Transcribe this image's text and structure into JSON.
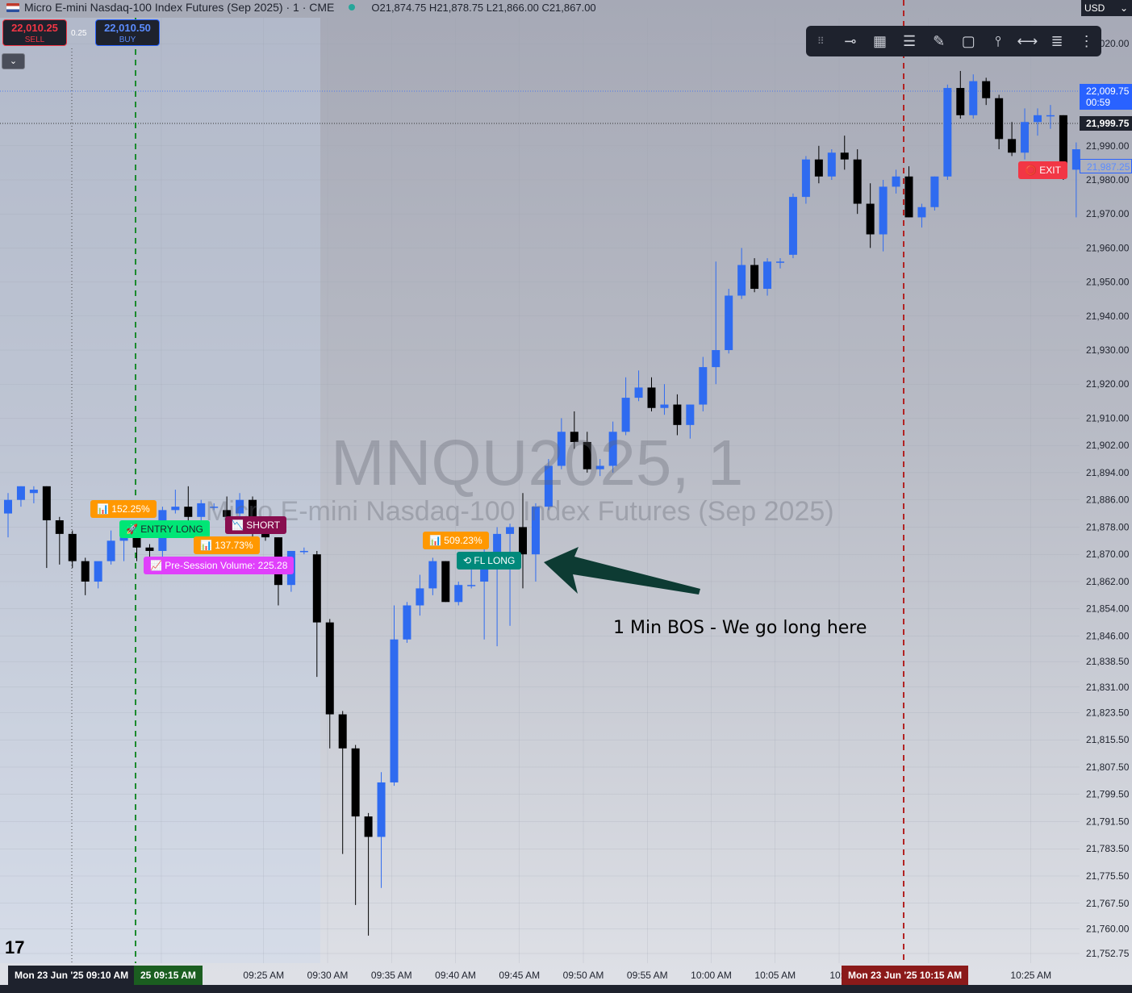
{
  "header": {
    "title": "Micro E-mini Nasdaq-100 Index Futures (Sep 2025) · 1 · CME",
    "ohlc": "O21,874.75  H21,878.75  L21,866.00  C21,867.00",
    "currency": "USD"
  },
  "trade_panel": {
    "sell_price": "22,010.25",
    "sell_label": "SELL",
    "spread": "0.25",
    "buy_price": "22,010.50",
    "buy_label": "BUY"
  },
  "watermark": {
    "symbol": "MNQU2025, 1",
    "name": "Micro E-mini Nasdaq-100 Index Futures (Sep 2025)"
  },
  "labels": {
    "vol1": "📊 152.25%",
    "entry_long": "🚀 ENTRY LONG",
    "short": "📉 SHORT",
    "vol2": "📊 137.73%",
    "presession": "📈 Pre-Session Volume: 225.28",
    "vol3": "📊 509.23%",
    "fl_long": "⟲ FL LONG",
    "exit": "⭕ EXIT",
    "annotation": "1 Min BOS - We go long here"
  },
  "price_tags": {
    "ask": "22,009.75",
    "countdown": "00:59",
    "crosshair": "21,999.75",
    "exit_level": "21,987.25"
  },
  "time_tags": {
    "left": "Mon 23 Jun '25   09:10 AM",
    "green": "25   09:15 AM",
    "red": "Mon 23 Jun '25   10:15 AM"
  },
  "colors": {
    "up": "#2f6bf0",
    "down": "#000000",
    "sell": "#f23645",
    "buy": "#2962ff",
    "green_line": "#1b8a2e",
    "red_line": "#b22222",
    "arrow": "#0d3b33"
  },
  "toolbar": {
    "icons": [
      "drag-handle-icon",
      "line-tool-icon",
      "grid-icon",
      "lines-icon",
      "brush-icon",
      "rectangle-icon",
      "vertical-line-icon",
      "horizontal-line-icon",
      "settings-lines-icon",
      "menu-lines-icon"
    ]
  },
  "chart_data": {
    "type": "candlestick",
    "ylim": [
      21752.75,
      22030.0
    ],
    "yticks": [
      22020.0,
      21990.0,
      21980.0,
      21970.0,
      21960.0,
      21950.0,
      21940.0,
      21930.0,
      21920.0,
      21910.0,
      21902.0,
      21894.0,
      21886.0,
      21878.0,
      21870.0,
      21862.0,
      21854.0,
      21846.0,
      21838.5,
      21831.0,
      21823.5,
      21815.5,
      21807.5,
      21799.5,
      21791.5,
      21783.5,
      21775.5,
      21767.5,
      21760.0,
      21752.75
    ],
    "ytick_labels": [
      "22,020.00",
      "21,990.00",
      "21,980.00",
      "21,970.00",
      "21,960.00",
      "21,950.00",
      "21,940.00",
      "21,930.00",
      "21,920.00",
      "21,910.00",
      "21,902.00",
      "21,894.00",
      "21,886.00",
      "21,878.00",
      "21,870.00",
      "21,862.00",
      "21,854.00",
      "21,846.00",
      "21,838.50",
      "21,831.00",
      "21,823.50",
      "21,815.50",
      "21,807.50",
      "21,799.50",
      "21,791.50",
      "21,783.50",
      "21,775.50",
      "21,767.50",
      "21,760.00",
      "21,752.75"
    ],
    "xtick_labels": [
      "0 AM",
      "09:25 AM",
      "09:30 AM",
      "09:35 AM",
      "09:40 AM",
      "09:45 AM",
      "09:50 AM",
      "09:55 AM",
      "10:00 AM",
      "10:05 AM",
      "10:1",
      "0 AM",
      "10:25 AM"
    ],
    "xtick_minutes": [
      17,
      25,
      30,
      35,
      40,
      45,
      50,
      55,
      60,
      65,
      70,
      77,
      85
    ],
    "candles": [
      {
        "o": 21882,
        "h": 21888,
        "l": 21875,
        "c": 21886
      },
      {
        "o": 21886,
        "h": 21890,
        "l": 21884,
        "c": 21890
      },
      {
        "o": 21888,
        "h": 21890,
        "l": 21885,
        "c": 21889
      },
      {
        "o": 21890,
        "h": 21890,
        "l": 21866,
        "c": 21880
      },
      {
        "o": 21880,
        "h": 21881,
        "l": 21867,
        "c": 21876
      },
      {
        "o": 21876,
        "h": 21877,
        "l": 21866,
        "c": 21868
      },
      {
        "o": 21868,
        "h": 21869,
        "l": 21858,
        "c": 21862
      },
      {
        "o": 21862,
        "h": 21867,
        "l": 21860,
        "c": 21868
      },
      {
        "o": 21868,
        "h": 21877,
        "l": 21867,
        "c": 21874
      },
      {
        "o": 21874,
        "h": 21876,
        "l": 21868,
        "c": 21875
      },
      {
        "o": 21875,
        "h": 21878,
        "l": 21868,
        "c": 21872
      },
      {
        "o": 21872,
        "h": 21873,
        "l": 21868,
        "c": 21871
      },
      {
        "o": 21871,
        "h": 21884,
        "l": 21869,
        "c": 21883
      },
      {
        "o": 21883,
        "h": 21889,
        "l": 21882,
        "c": 21884
      },
      {
        "o": 21884,
        "h": 21890,
        "l": 21880,
        "c": 21881
      },
      {
        "o": 21881,
        "h": 21886,
        "l": 21879,
        "c": 21885
      },
      {
        "o": 21884,
        "h": 21885,
        "l": 21883,
        "c": 21884
      },
      {
        "o": 21883,
        "h": 21887,
        "l": 21880,
        "c": 21881
      },
      {
        "o": 21882,
        "h": 21888,
        "l": 21879,
        "c": 21886
      },
      {
        "o": 21886,
        "h": 21887,
        "l": 21874,
        "c": 21877
      },
      {
        "o": 21877,
        "h": 21877,
        "l": 21874,
        "c": 21875
      },
      {
        "o": 21875,
        "h": 21875,
        "l": 21855,
        "c": 21861
      },
      {
        "o": 21861,
        "h": 21871,
        "l": 21859,
        "c": 21871
      },
      {
        "o": 21871,
        "h": 21872,
        "l": 21870,
        "c": 21871
      },
      {
        "o": 21870,
        "h": 21871,
        "l": 21834,
        "c": 21850
      },
      {
        "o": 21850,
        "h": 21851,
        "l": 21813,
        "c": 21823
      },
      {
        "o": 21823,
        "h": 21824,
        "l": 21782,
        "c": 21813
      },
      {
        "o": 21813,
        "h": 21814,
        "l": 21767,
        "c": 21793
      },
      {
        "o": 21793,
        "h": 21794,
        "l": 21758,
        "c": 21787
      },
      {
        "o": 21787,
        "h": 21806,
        "l": 21772,
        "c": 21803
      },
      {
        "o": 21803,
        "h": 21855,
        "l": 21802,
        "c": 21845
      },
      {
        "o": 21845,
        "h": 21856,
        "l": 21844,
        "c": 21855
      },
      {
        "o": 21855,
        "h": 21864,
        "l": 21852,
        "c": 21860
      },
      {
        "o": 21860,
        "h": 21869,
        "l": 21858,
        "c": 21868
      },
      {
        "o": 21868,
        "h": 21868,
        "l": 21856,
        "c": 21856
      },
      {
        "o": 21856,
        "h": 21862,
        "l": 21855,
        "c": 21861
      },
      {
        "o": 21861,
        "h": 21870,
        "l": 21860,
        "c": 21861
      },
      {
        "o": 21862,
        "h": 21876,
        "l": 21845,
        "c": 21868
      },
      {
        "o": 21868,
        "h": 21878,
        "l": 21843,
        "c": 21876
      },
      {
        "o": 21876,
        "h": 21879,
        "l": 21849,
        "c": 21878
      },
      {
        "o": 21878,
        "h": 21888,
        "l": 21860,
        "c": 21870
      },
      {
        "o": 21870,
        "h": 21885,
        "l": 21862,
        "c": 21884
      },
      {
        "o": 21884,
        "h": 21898,
        "l": 21883,
        "c": 21896
      },
      {
        "o": 21896,
        "h": 21910,
        "l": 21895,
        "c": 21906
      },
      {
        "o": 21906,
        "h": 21912,
        "l": 21901,
        "c": 21903
      },
      {
        "o": 21903,
        "h": 21906,
        "l": 21894,
        "c": 21895
      },
      {
        "o": 21895,
        "h": 21898,
        "l": 21893,
        "c": 21896
      },
      {
        "o": 21896,
        "h": 21909,
        "l": 21894,
        "c": 21906
      },
      {
        "o": 21906,
        "h": 21922,
        "l": 21905,
        "c": 21916
      },
      {
        "o": 21916,
        "h": 21924,
        "l": 21915,
        "c": 21919
      },
      {
        "o": 21919,
        "h": 21922,
        "l": 21912,
        "c": 21913
      },
      {
        "o": 21913,
        "h": 21920,
        "l": 21911,
        "c": 21914
      },
      {
        "o": 21914,
        "h": 21917,
        "l": 21905,
        "c": 21908
      },
      {
        "o": 21908,
        "h": 21914,
        "l": 21904,
        "c": 21914
      },
      {
        "o": 21914,
        "h": 21928,
        "l": 21912,
        "c": 21925
      },
      {
        "o": 21925,
        "h": 21956,
        "l": 21920,
        "c": 21930
      },
      {
        "o": 21930,
        "h": 21948,
        "l": 21929,
        "c": 21946
      },
      {
        "o": 21946,
        "h": 21960,
        "l": 21945,
        "c": 21955
      },
      {
        "o": 21955,
        "h": 21957,
        "l": 21947,
        "c": 21948
      },
      {
        "o": 21948,
        "h": 21957,
        "l": 21946,
        "c": 21956
      },
      {
        "o": 21956,
        "h": 21957,
        "l": 21954,
        "c": 21956
      },
      {
        "o": 21958,
        "h": 21976,
        "l": 21957,
        "c": 21975
      },
      {
        "o": 21975,
        "h": 21987,
        "l": 21973,
        "c": 21986
      },
      {
        "o": 21986,
        "h": 21990,
        "l": 21979,
        "c": 21981
      },
      {
        "o": 21981,
        "h": 21989,
        "l": 21980,
        "c": 21988
      },
      {
        "o": 21988,
        "h": 21993,
        "l": 21983,
        "c": 21986
      },
      {
        "o": 21986,
        "h": 21989,
        "l": 21970,
        "c": 21973
      },
      {
        "o": 21973,
        "h": 21979,
        "l": 21960,
        "c": 21964
      },
      {
        "o": 21964,
        "h": 21980,
        "l": 21959,
        "c": 21978
      },
      {
        "o": 21978,
        "h": 21983,
        "l": 21976,
        "c": 21981
      },
      {
        "o": 21981,
        "h": 21984,
        "l": 21969,
        "c": 21969
      },
      {
        "o": 21969,
        "h": 21973,
        "l": 21966,
        "c": 21972
      },
      {
        "o": 21972,
        "h": 21981,
        "l": 21971,
        "c": 21981
      },
      {
        "o": 21981,
        "h": 22008,
        "l": 21980,
        "c": 22007
      },
      {
        "o": 22007,
        "h": 22012,
        "l": 21998,
        "c": 21999
      },
      {
        "o": 21999,
        "h": 22011,
        "l": 21998,
        "c": 22009
      },
      {
        "o": 22009,
        "h": 22010,
        "l": 22002,
        "c": 22004
      },
      {
        "o": 22004,
        "h": 22005,
        "l": 21989,
        "c": 21992
      },
      {
        "o": 21992,
        "h": 21997,
        "l": 21987,
        "c": 21988
      },
      {
        "o": 21988,
        "h": 22001,
        "l": 21986,
        "c": 21997
      },
      {
        "o": 21997,
        "h": 22001,
        "l": 21993,
        "c": 21999
      },
      {
        "o": 21999,
        "h": 22002,
        "l": 21995,
        "c": 21999
      },
      {
        "o": 21999,
        "h": 21999,
        "l": 21980,
        "c": 21983
      },
      {
        "o": 21983,
        "h": 21991,
        "l": 21969,
        "c": 21989
      }
    ]
  }
}
